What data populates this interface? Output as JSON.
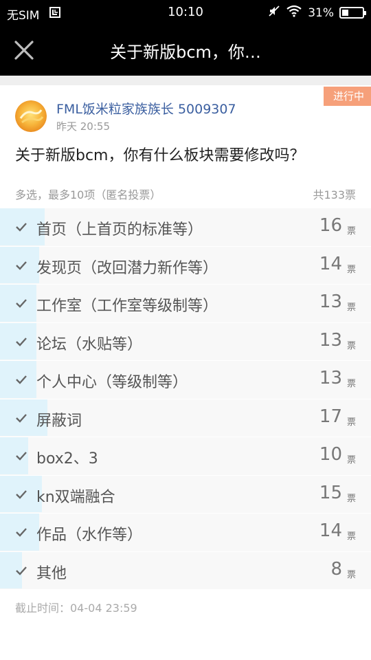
{
  "status_bar": {
    "carrier": "无SIM",
    "time": "10:10",
    "battery_text": "31%",
    "battery_level": 0.31
  },
  "nav": {
    "title": "关于新版bcm，你…"
  },
  "post": {
    "status_badge": "进行中",
    "author": "FML饭米粒家族族长 5009307",
    "time": "昨天 20:55",
    "question": "关于新版bcm，你有什么板块需要修改吗？",
    "vote_hint": "多选，最多10项（匿名投票）",
    "vote_total": "共133票",
    "deadline": "截止时间：04-04 23:59"
  },
  "colors": {
    "accent_badge": "#f6a07a",
    "bar_fill": "#e0f3fb",
    "author_link": "#3b5fa0"
  },
  "options": [
    {
      "label": "首页（上首页的标准等）",
      "count": "16",
      "unit": "票",
      "share": 0.12
    },
    {
      "label": "发现页（改回潜力新作等）",
      "count": "14",
      "unit": "票",
      "share": 0.105
    },
    {
      "label": "工作室（工作室等级制等）",
      "count": "13",
      "unit": "票",
      "share": 0.098
    },
    {
      "label": "论坛（水贴等）",
      "count": "13",
      "unit": "票",
      "share": 0.098
    },
    {
      "label": "个人中心（等级制等）",
      "count": "13",
      "unit": "票",
      "share": 0.098
    },
    {
      "label": "屏蔽词",
      "count": "17",
      "unit": "票",
      "share": 0.128
    },
    {
      "label": "box2、3",
      "count": "10",
      "unit": "票",
      "share": 0.075
    },
    {
      "label": "kn双端融合",
      "count": "15",
      "unit": "票",
      "share": 0.113
    },
    {
      "label": "作品（水作等）",
      "count": "14",
      "unit": "票",
      "share": 0.105
    },
    {
      "label": "其他",
      "count": "8",
      "unit": "票",
      "share": 0.06
    }
  ]
}
